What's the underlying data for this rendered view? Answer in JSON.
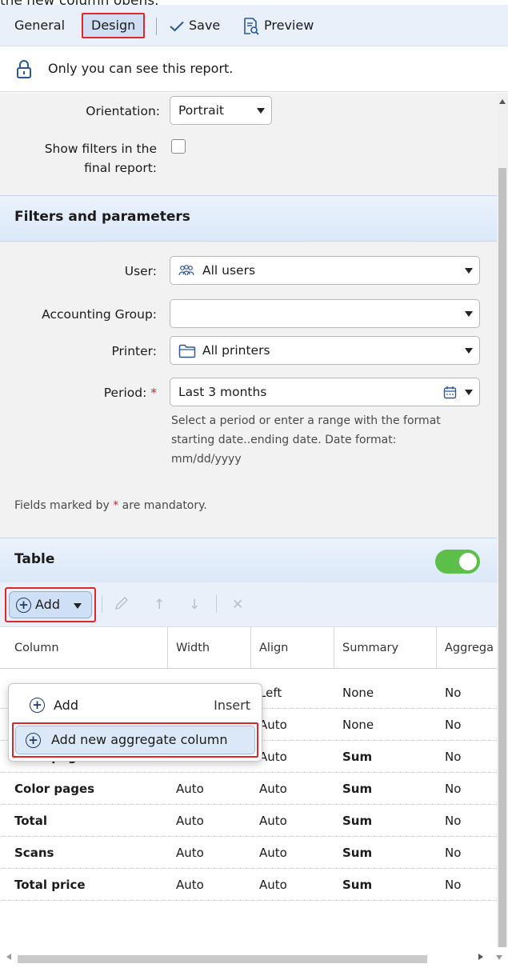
{
  "caption": "the new column opens.",
  "toolbar": {
    "general": "General",
    "design": "Design",
    "save": "Save",
    "preview": "Preview"
  },
  "privacy": {
    "text": "Only you can see this report.",
    "icon": "lock-icon"
  },
  "settings": {
    "orientation_label": "Orientation:",
    "orientation_value": "Portrait",
    "show_filters_label_line1": "Show filters in the",
    "show_filters_label_line2": "final report:",
    "show_filters_checked": false
  },
  "filters": {
    "title": "Filters and parameters",
    "user_label": "User:",
    "user_value": "All users",
    "group_label": "Accounting Group:",
    "group_value": "",
    "printer_label": "Printer:",
    "printer_value": "All printers",
    "period_label": "Period:",
    "period_required": "*",
    "period_value": "Last 3 months",
    "period_hint_1": "Select a period or enter a range with the format",
    "period_hint_2": "starting date..ending date. Date format:",
    "period_hint_3": "mm/dd/yyyy",
    "mandatory_prefix": "Fields marked by ",
    "mandatory_star": "*",
    "mandatory_suffix": " are mandatory."
  },
  "table": {
    "title": "Table",
    "enabled": true,
    "add_label": "Add",
    "columns": [
      "Column",
      "Width",
      "Align",
      "Summary",
      "Aggrega"
    ],
    "rows": [
      {
        "column": "",
        "width": "",
        "align": "Left",
        "summary": "None",
        "agg": "No"
      },
      {
        "column": "",
        "width": "",
        "align": "Auto",
        "summary": "None",
        "agg": "No"
      },
      {
        "column": "B&W pages",
        "width": "Auto",
        "align": "Auto",
        "summary": "Sum",
        "agg": "No"
      },
      {
        "column": "Color pages",
        "width": "Auto",
        "align": "Auto",
        "summary": "Sum",
        "agg": "No"
      },
      {
        "column": "Total",
        "width": "Auto",
        "align": "Auto",
        "summary": "Sum",
        "agg": "No"
      },
      {
        "column": "Scans",
        "width": "Auto",
        "align": "Auto",
        "summary": "Sum",
        "agg": "No"
      },
      {
        "column": "Total price",
        "width": "Auto",
        "align": "Auto",
        "summary": "Sum",
        "agg": "No"
      }
    ]
  },
  "menu": {
    "add_label": "Add",
    "add_shortcut": "Insert",
    "add_aggregate_label": "Add new aggregate column"
  },
  "colors": {
    "accent_red": "#e0262a",
    "toggle_green": "#5bbf4a",
    "header_blue": "#dbe8f8"
  }
}
